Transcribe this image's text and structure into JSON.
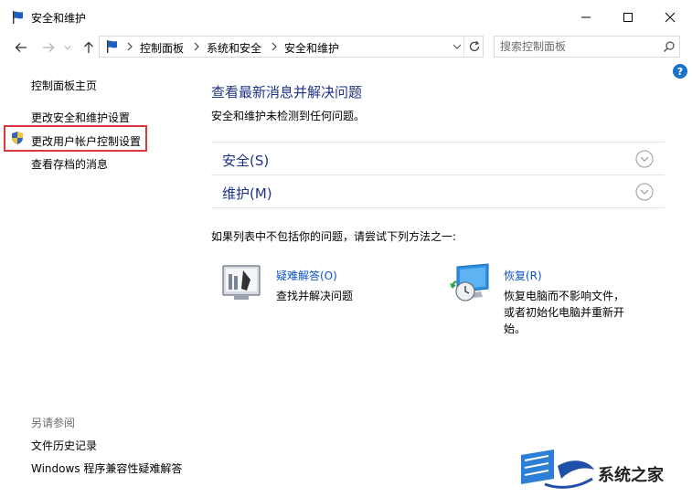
{
  "window": {
    "title": "安全和维护"
  },
  "address": {
    "breadcrumbs": [
      "控制面板",
      "系统和安全",
      "安全和维护"
    ]
  },
  "search": {
    "placeholder": "搜索控制面板"
  },
  "sidebar": {
    "home_link": "控制面板主页",
    "items": [
      "更改安全和维护设置",
      "更改用户帐户控制设置",
      "查看存档的消息"
    ],
    "see_also_label": "另请参阅",
    "see_also": [
      "文件历史记录",
      "Windows 程序兼容性疑难解答"
    ]
  },
  "main": {
    "title": "查看最新消息并解决问题",
    "status": "安全和维护未检测到任何问题。",
    "sections": [
      "安全(S)",
      "维护(M)"
    ],
    "try_text": "如果列表中不包括你的问题，请尝试下列方法之一:",
    "troubleshoot": {
      "label": "疑难解答(O)",
      "desc": "查找并解决问题"
    },
    "recovery": {
      "label": "恢复(R)",
      "desc_lines": [
        "恢复电脑而不影响文件，",
        "或者初始化电脑并重新开",
        "始。"
      ]
    }
  },
  "watermark": {
    "text": "系统之家"
  },
  "colors": {
    "heading_blue": "#1e3287",
    "link_blue": "#0b53c6",
    "highlight_red": "#d9363e"
  }
}
